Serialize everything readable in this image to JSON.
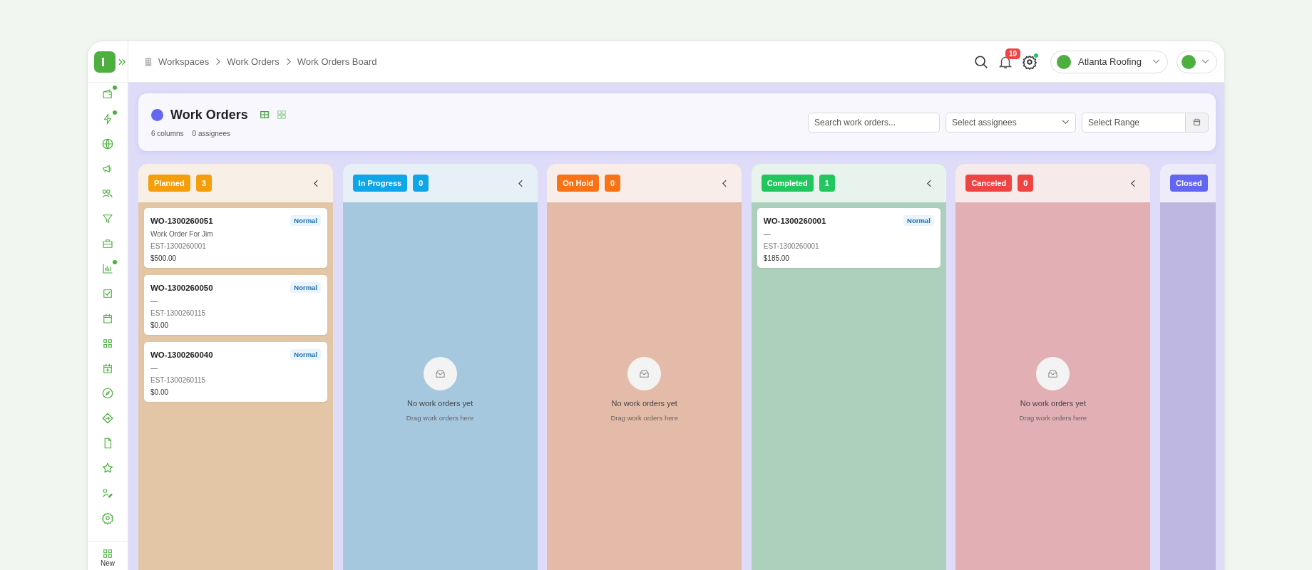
{
  "sidebar": {
    "items": [
      {
        "dot": true
      },
      {
        "dot": true
      },
      {
        "dot": false
      },
      {
        "dot": false
      },
      {
        "dot": false
      },
      {
        "dot": false
      },
      {
        "dot": false
      },
      {
        "dot": true
      },
      {
        "dot": false
      },
      {
        "dot": false
      },
      {
        "dot": false
      },
      {
        "dot": false
      },
      {
        "dot": false
      },
      {
        "dot": false
      },
      {
        "dot": false
      },
      {
        "dot": false
      },
      {
        "dot": false
      },
      {
        "dot": false
      }
    ],
    "new_label": "New"
  },
  "breadcrumb": [
    "Workspaces",
    "Work Orders",
    "Work Orders Board"
  ],
  "topbar": {
    "notifications": "10",
    "settings_dot": true,
    "company": "Atlanta Roofing"
  },
  "header": {
    "title": "Work Orders",
    "color": "#6366f1",
    "columns_count": "6 columns",
    "assignees_count": "0 assignees",
    "views": [
      {
        "selected": true
      },
      {
        "selected": false
      }
    ],
    "search": {
      "placeholder": "Search work orders..."
    },
    "assignees": {
      "placeholder": "Select assignees"
    },
    "range": {
      "placeholder": "Select Range"
    }
  },
  "columns": [
    {
      "name": "Planned",
      "color": "#f59e0b",
      "count": "3",
      "cards": [
        {
          "id": "WO-1300260051",
          "priority": "Normal",
          "description": "Work Order For Jim",
          "estimate": "EST-1300260001",
          "amount": "$500.00"
        },
        {
          "id": "WO-1300260050",
          "priority": "Normal",
          "description": "—",
          "estimate": "EST-1300260115",
          "amount": "$0.00"
        },
        {
          "id": "WO-1300260040",
          "priority": "Normal",
          "description": "—",
          "estimate": "EST-1300260115",
          "amount": "$0.00"
        }
      ]
    },
    {
      "name": "In Progress",
      "color": "#0ea5e9",
      "count": "0",
      "empty_title": "No work orders yet",
      "empty_hint": "Drag work orders here"
    },
    {
      "name": "On Hold",
      "color": "#f97316",
      "count": "0",
      "empty_title": "No work orders yet",
      "empty_hint": "Drag work orders here"
    },
    {
      "name": "Completed",
      "color": "#22c55e",
      "count": "1",
      "cards": [
        {
          "id": "WO-1300260001",
          "priority": "Normal",
          "description": "—",
          "estimate": "EST-1300260001",
          "amount": "$185.00"
        }
      ]
    },
    {
      "name": "Canceled",
      "color": "#ef4444",
      "count": "0",
      "empty_title": "No work orders yet",
      "empty_hint": "Drag work orders here"
    },
    {
      "name": "Closed",
      "color": "#6366f1"
    }
  ]
}
